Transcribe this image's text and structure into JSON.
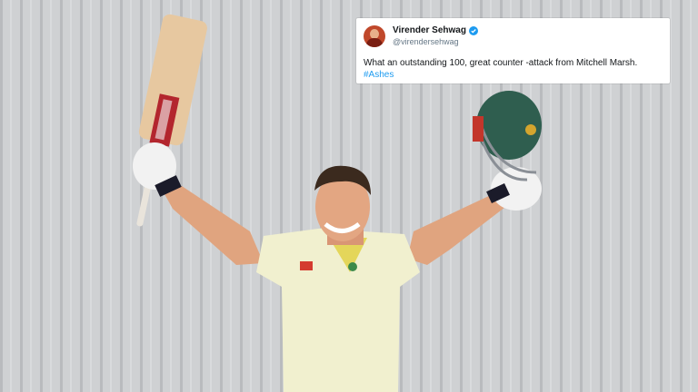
{
  "tweet": {
    "display_name": "Virender Sehwag",
    "handle": "@virendersehwag",
    "text": "What an outstanding 100, great counter -attack from Mitchell Marsh.",
    "hashtag": "#Ashes",
    "verified_color": "#1d9bf0"
  },
  "photo": {
    "background_color": "#c9cbcd",
    "shirt_color": "#f1f0cf",
    "helmet_color": "#2f5e4f",
    "bat_color": "#e7c8a0"
  }
}
